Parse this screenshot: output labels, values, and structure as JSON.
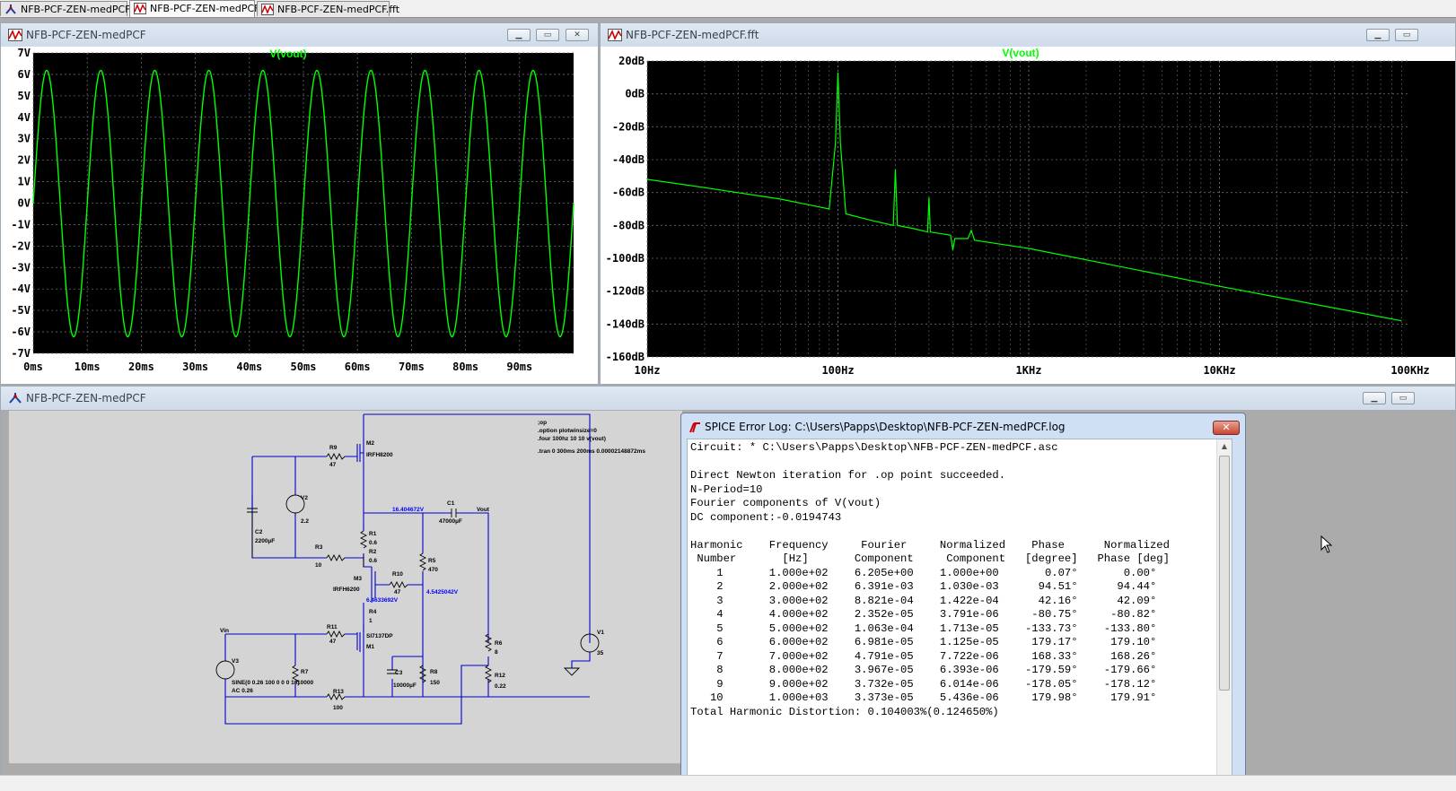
{
  "tabs": [
    {
      "label": "NFB-PCF-ZEN-medPCF",
      "icon": "schematic-icon"
    },
    {
      "label": "NFB-PCF-ZEN-medPCF",
      "icon": "waveform-icon"
    },
    {
      "label": "NFB-PCF-ZEN-medPCF.fft",
      "icon": "waveform-icon"
    }
  ],
  "time_window": {
    "title": "NFB-PCF-ZEN-medPCF",
    "trace_label": "V(vout)",
    "trace_color": "#00ff00",
    "y_ticks": [
      "7V",
      "6V",
      "5V",
      "4V",
      "3V",
      "2V",
      "1V",
      "0V",
      "-1V",
      "-2V",
      "-3V",
      "-4V",
      "-5V",
      "-6V",
      "-7V"
    ],
    "x_ticks": [
      "0ms",
      "10ms",
      "20ms",
      "30ms",
      "40ms",
      "50ms",
      "60ms",
      "70ms",
      "80ms",
      "90ms"
    ]
  },
  "fft_window": {
    "title": "NFB-PCF-ZEN-medPCF.fft",
    "trace_label": "V(vout)",
    "y_ticks": [
      "20dB",
      "0dB",
      "-20dB",
      "-40dB",
      "-60dB",
      "-80dB",
      "-100dB",
      "-120dB",
      "-140dB",
      "-160dB"
    ],
    "x_ticks": [
      "10Hz",
      "100Hz",
      "1KHz",
      "10KHz",
      "100KHz"
    ]
  },
  "chart_data": [
    {
      "type": "line",
      "title": "V(vout)",
      "xlabel": "",
      "ylabel": "",
      "x_unit": "ms",
      "y_unit": "V",
      "xlim": [
        0,
        100
      ],
      "ylim": [
        -7,
        7
      ],
      "grid": true,
      "series": [
        {
          "name": "V(vout)",
          "waveform": "sine",
          "frequency_hz": 100,
          "amplitude_v": 6.205,
          "dc_offset_v": -0.0194743,
          "x_start_ms": 0,
          "x_end_ms": 100
        }
      ]
    },
    {
      "type": "line",
      "title": "V(vout)",
      "xlabel": "",
      "ylabel": "",
      "x_scale": "log",
      "x_unit": "Hz",
      "y_unit": "dB",
      "xlim": [
        10,
        100000
      ],
      "ylim": [
        -160,
        20
      ],
      "grid": true,
      "series": [
        {
          "name": "V(vout)",
          "x": [
            10,
            20,
            50,
            90,
            97,
            100,
            103,
            110,
            150,
            195,
            200,
            205,
            250,
            295,
            300,
            305,
            390,
            400,
            410,
            480,
            500,
            520,
            1000,
            10000,
            90000
          ],
          "y": [
            -52,
            -57,
            -64,
            -70,
            -30,
            13,
            -30,
            -73,
            -77,
            -80,
            -46,
            -80,
            -82,
            -84,
            -63,
            -84,
            -86,
            -95,
            -88,
            -88,
            -83,
            -89,
            -94,
            -117,
            -138
          ]
        }
      ]
    }
  ],
  "schematic": {
    "title": "NFB-PCF-ZEN-medPCF",
    "spice_directives": [
      ";op",
      ".option plotwinsize=0",
      ".four 100hz 10 10 v(vout)",
      ".tran 0 300ms 200ms 0.00002148872ms"
    ],
    "components": [
      {
        "ref": "R9",
        "value": "47"
      },
      {
        "ref": "M2",
        "value": "IRFH8200"
      },
      {
        "ref": "R1",
        "value": "0.6"
      },
      {
        "ref": "C2",
        "value": "2200µF"
      },
      {
        "ref": "V2",
        "value": "2.2"
      },
      {
        "ref": "R2",
        "value": "0.6"
      },
      {
        "ref": "C1",
        "value": "47000µF"
      },
      {
        "ref": "R3",
        "value": "10"
      },
      {
        "ref": "R5",
        "value": "470"
      },
      {
        "ref": "M3",
        "value": "IRFH6200"
      },
      {
        "ref": "R10",
        "value": "47"
      },
      {
        "ref": "R4",
        "value": "1"
      },
      {
        "ref": "R11",
        "value": "47"
      },
      {
        "ref": "M1",
        "value": "SI7137DP"
      },
      {
        "ref": "V3",
        "value": "SINE(0 0.26 100 0 0 0 10)"
      },
      {
        "ref": "R7",
        "value": "10000"
      },
      {
        "ref": "R13",
        "value": "100"
      },
      {
        "ref": "C3",
        "value": "10000µF"
      },
      {
        "ref": "R8",
        "value": "150"
      },
      {
        "ref": "R6",
        "value": "8"
      },
      {
        "ref": "R12",
        "value": "0.22"
      },
      {
        "ref": "V1",
        "value": "35"
      }
    ],
    "ac_label": "AC 0.26",
    "net_labels": [
      "Vout",
      "Vin"
    ],
    "node_voltages": [
      "16.404672V",
      "6.4633692V",
      "4.5425042V"
    ]
  },
  "error_log": {
    "title": "SPICE Error Log: C:\\Users\\Papps\\Desktop\\NFB-PCF-ZEN-medPCF.log",
    "close_label": "✕",
    "lines": [
      "Circuit: * C:\\Users\\Papps\\Desktop\\NFB-PCF-ZEN-medPCF.asc",
      "",
      "Direct Newton iteration for .op point succeeded.",
      "N-Period=10",
      "Fourier components of V(vout)",
      "DC component:-0.0194743",
      "",
      "Harmonic    Frequency     Fourier     Normalized    Phase      Normalized",
      " Number       [Hz]       Component     Component   [degree]   Phase [deg]",
      "    1       1.000e+02    6.205e+00    1.000e+00       0.07°       0.00°",
      "    2       2.000e+02    6.391e-03    1.030e-03      94.51°      94.44°",
      "    3       3.000e+02    8.821e-04    1.422e-04      42.16°      42.09°",
      "    4       4.000e+02    2.352e-05    3.791e-06     -80.75°     -80.82°",
      "    5       5.000e+02    1.063e-04    1.713e-05    -133.73°    -133.80°",
      "    6       6.000e+02    6.981e-05    1.125e-05     179.17°     179.10°",
      "    7       7.000e+02    4.791e-05    7.722e-06     168.33°     168.26°",
      "    8       8.000e+02    3.967e-05    6.393e-06    -179.59°    -179.66°",
      "    9       9.000e+02    3.732e-05    6.014e-06    -178.05°    -178.12°",
      "   10       1.000e+03    3.373e-05    5.436e-06     179.98°     179.91°",
      "Total Harmonic Distortion: 0.104003%(0.124650%)"
    ]
  }
}
